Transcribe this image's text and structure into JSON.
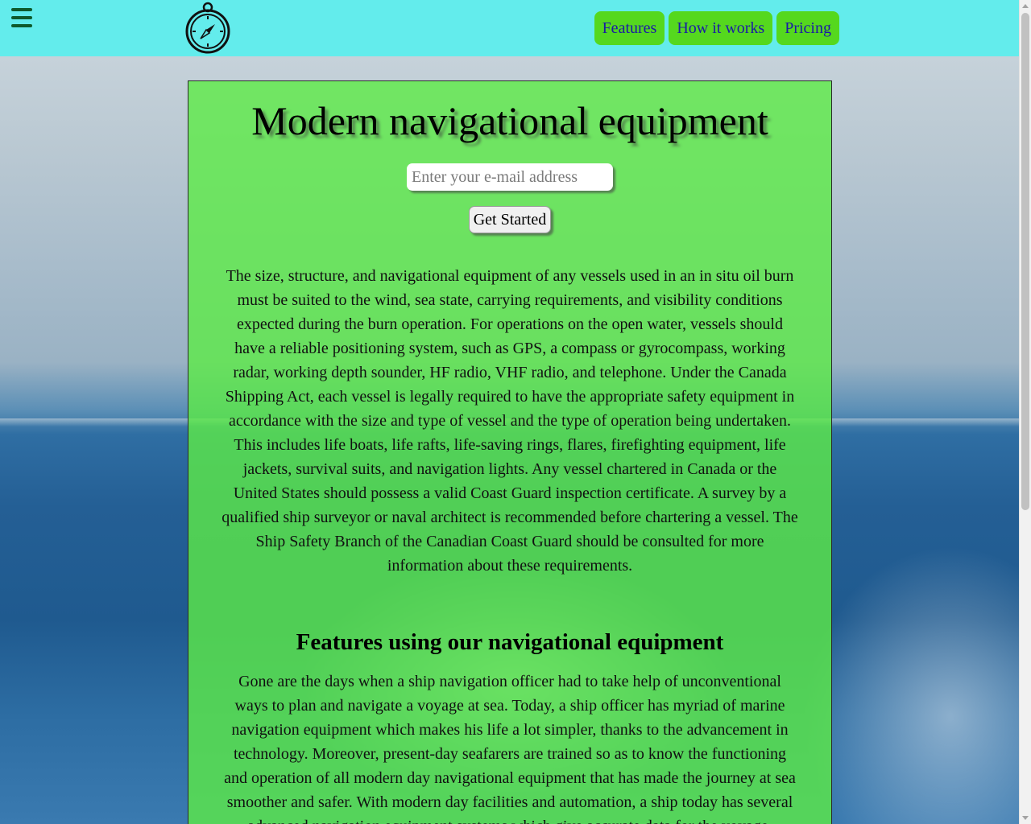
{
  "header": {
    "menu_icon": "hamburger-menu-icon",
    "logo_icon": "compass-icon",
    "nav": [
      {
        "label": "Features"
      },
      {
        "label": "How it works"
      },
      {
        "label": "Pricing"
      }
    ]
  },
  "hero": {
    "title": "Modern navigational equipment",
    "email_placeholder": "Enter your e-mail address",
    "cta_label": "Get Started"
  },
  "intro_paragraph": "The size, structure, and navigational equipment of any vessels used in an in situ oil burn must be suited to the wind, sea state, carrying requirements, and visibility conditions expected during the burn operation. For operations on the open water, vessels should have a reliable positioning system, such as GPS, a compass or gyrocompass, working radar, working depth sounder, HF radio, VHF radio, and telephone. Under the Canada Shipping Act, each vessel is legally required to have the appropriate safety equipment in accordance with the size and type of vessel and the type of operation being undertaken. This includes life boats, life rafts, life-saving rings, flares, firefighting equipment, life jackets, survival suits, and navigation lights. Any vessel chartered in Canada or the United States should possess a valid Coast Guard inspection certificate. A survey by a qualified ship surveyor or naval architect is recommended before chartering a vessel. The Ship Safety Branch of the Canadian Coast Guard should be consulted for more information about these requirements.",
  "features": {
    "heading": "Features using our navigational equipment",
    "paragraph": "Gone are the days when a ship navigation officer had to take help of unconventional ways to plan and navigate a voyage at sea. Today, a ship officer has myriad of marine navigation equipment which makes his life a lot simpler, thanks to the advancement in technology. Moreover, present-day seafarers are trained so as to know the functioning and operation of all modern day navigational equipment that has made the journey at sea smoother and safer. With modern day facilities and automation, a ship today has several advanced navigation equipment systems which give accurate data for the voyage."
  },
  "colors": {
    "header_bg": "#63ecec",
    "nav_button_bg": "#55d81e",
    "nav_text": "#1a1aa6",
    "card_bg": "#5ceb46"
  }
}
